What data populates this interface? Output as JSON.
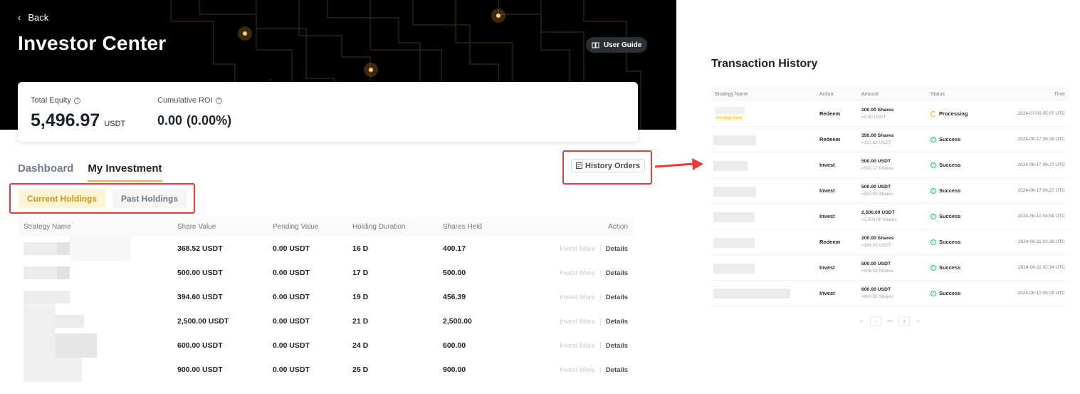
{
  "left": {
    "back_label": "Back",
    "title": "Investor Center",
    "user_guide_label": "User Guide",
    "summary": {
      "total_equity_label": "Total Equity",
      "total_equity_value": "5,496.97",
      "total_equity_unit": "USDT",
      "roi_label": "Cumulative ROI",
      "roi_value": "0.00",
      "roi_pct": "(0.00%)"
    },
    "tabs": [
      "Dashboard",
      "My Investment"
    ],
    "history_orders_label": "History Orders",
    "subtabs": [
      "Current Holdings",
      "Past Holdings"
    ],
    "holdings": {
      "columns": [
        "Strategy Name",
        "Share Value",
        "Pending Value",
        "Holding Duration",
        "Shares Held",
        "Action"
      ],
      "invest_more_label": "Invest More",
      "details_label": "Details",
      "rows": [
        {
          "share_value": "368.52 USDT",
          "pending": "0.00 USDT",
          "duration": "16 D",
          "shares": "400.17"
        },
        {
          "share_value": "500.00 USDT",
          "pending": "0.00 USDT",
          "duration": "17 D",
          "shares": "500.00"
        },
        {
          "share_value": "394.60 USDT",
          "pending": "0.00 USDT",
          "duration": "19 D",
          "shares": "456.39"
        },
        {
          "share_value": "2,500.00 USDT",
          "pending": "0.00 USDT",
          "duration": "21 D",
          "shares": "2,500.00"
        },
        {
          "share_value": "600.00 USDT",
          "pending": "0.00 USDT",
          "duration": "24 D",
          "shares": "600.00"
        },
        {
          "share_value": "900.00 USDT",
          "pending": "0.00 USDT",
          "duration": "25 D",
          "shares": "900.00"
        }
      ]
    }
  },
  "right": {
    "title": "Transaction History",
    "columns": [
      "Strategy Name",
      "Action",
      "Amount",
      "Status",
      "Time"
    ],
    "pending_tag": "Pending Value",
    "rows": [
      {
        "action": "Redeem",
        "amount": "100.00 Shares",
        "sub": "≈0.00 USDT",
        "status": "Processing",
        "time": "2024-07-05 05:07 UTC"
      },
      {
        "action": "Redeem",
        "amount": "350.00 Shares",
        "sub": "≈317.02 USDT",
        "status": "Success",
        "time": "2024-06-17 09:28 UTC"
      },
      {
        "action": "Invest",
        "amount": "500.00 USDT",
        "sub": "≈500.17 Shares",
        "status": "Success",
        "time": "2024-06-17 09:27 UTC"
      },
      {
        "action": "Invest",
        "amount": "500.00 USDT",
        "sub": "≈500.00 Shares",
        "status": "Success",
        "time": "2024-06-17 09:27 UTC"
      },
      {
        "action": "Invest",
        "amount": "2,500.00 USDT",
        "sub": "≈2,500.00 Shares",
        "status": "Success",
        "time": "2024-06-12 04:54 UTC"
      },
      {
        "action": "Redeem",
        "amount": "200.00 Shares",
        "sub": "≈186.00 USDT",
        "status": "Success",
        "time": "2024-06-11 02:36 UTC"
      },
      {
        "action": "Invest",
        "amount": "500.00 USDT",
        "sub": "≈506.39 Shares",
        "status": "Success",
        "time": "2024-06-11 02:34 UTC"
      },
      {
        "action": "Invest",
        "amount": "600.00 USDT",
        "sub": "≈600.00 Shares",
        "status": "Success",
        "time": "2024-06-10 05:29 UTC"
      }
    ],
    "pager": [
      "«",
      "‹",
      "•••",
      "›",
      "»"
    ]
  },
  "colors": {
    "accent": "#f0b90b",
    "highlight": "#e8393b",
    "success": "#0ecb81"
  }
}
